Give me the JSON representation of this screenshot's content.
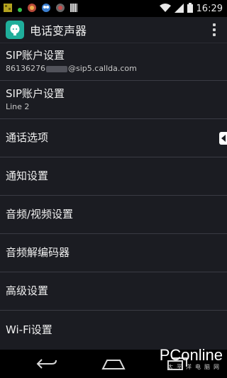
{
  "status_bar": {
    "clock": "16:29",
    "icons": [
      "app-notification-icon",
      "green-dot-icon",
      "app-icon-2",
      "app-icon-3",
      "app-icon-4",
      "app-icon-5",
      "wifi-icon",
      "signal-icon",
      "battery-icon"
    ]
  },
  "action_bar": {
    "title": "电话变声器",
    "app_icon": "github-cat-icon",
    "overflow_icon": "more-vertical-icon"
  },
  "settings_list": [
    {
      "title": "SIP账户设置",
      "subtitle_prefix": "86136276",
      "subtitle_suffix": "@sip5.callda.com"
    },
    {
      "title": "SIP账户设置",
      "subtitle": "Line 2"
    },
    {
      "title": "通话选项"
    },
    {
      "title": "通知设置"
    },
    {
      "title": "音频/视频设置"
    },
    {
      "title": "音频解编码器"
    },
    {
      "title": "高级设置"
    },
    {
      "title": "Wi-Fi设置"
    }
  ],
  "nav_bar": {
    "buttons": [
      "back-icon",
      "home-icon",
      "recents-icon"
    ]
  },
  "watermark": {
    "main": "PConline",
    "sub": "太平洋电脑网"
  },
  "colors": {
    "background": "#1b1c22",
    "app_icon_bg": "#1fae9b",
    "divider": "#3a3b44"
  }
}
